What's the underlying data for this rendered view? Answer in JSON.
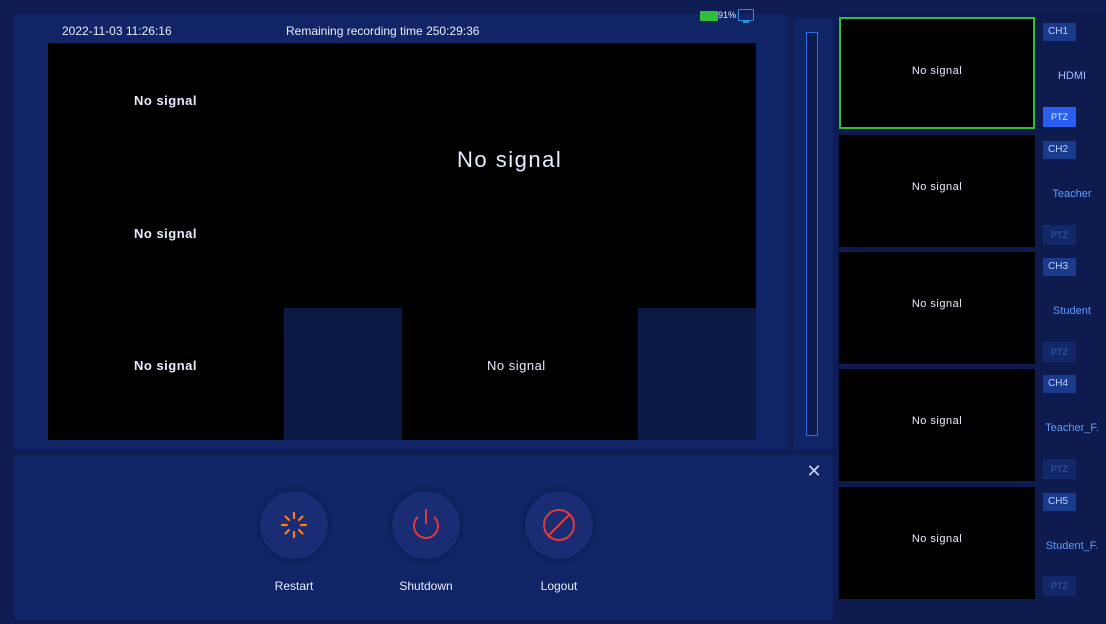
{
  "status": {
    "datetime": "2022-11-03 11:26:16",
    "recording": "Remaining recording time 250:29:36",
    "battery_percent": "91%"
  },
  "video": {
    "center_label": "No signal",
    "tiles": [
      "No signal",
      "No signal",
      "No signal",
      "No signal"
    ]
  },
  "controls": {
    "restart_label": "Restart",
    "shutdown_label": "Shutdown",
    "logout_label": "Logout",
    "accent_color": "#e03b3b",
    "restart_color": "#ff7a1a"
  },
  "channels": [
    {
      "tab": "CH1",
      "name": "HDMI",
      "thumb": "No signal",
      "ptz": "PTZ"
    },
    {
      "tab": "CH2",
      "name": "Teacher",
      "thumb": "No signal",
      "ptz": "PTZ"
    },
    {
      "tab": "CH3",
      "name": "Student",
      "thumb": "No signal",
      "ptz": "PTZ"
    },
    {
      "tab": "CH4",
      "name": "Teacher_F.",
      "thumb": "No signal",
      "ptz": "PTZ"
    },
    {
      "tab": "CH5",
      "name": "Student_F.",
      "thumb": "No signal",
      "ptz": "PTZ"
    }
  ],
  "colors": {
    "selected": "#2fbf3a",
    "ptz_active": "#2a5ef0"
  }
}
